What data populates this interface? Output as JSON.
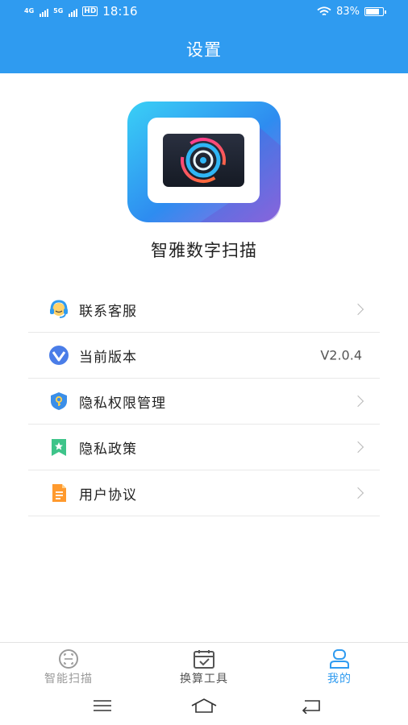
{
  "status_bar": {
    "network_1": "4G",
    "network_2": "5G",
    "hd": "HD",
    "time": "18:16",
    "battery_percent": "83%",
    "battery_level": 0.83
  },
  "header": {
    "title": "设置"
  },
  "app": {
    "name": "智雅数字扫描"
  },
  "menu": [
    {
      "label": "联系客服",
      "icon": "customer-service-icon"
    },
    {
      "label": "当前版本",
      "icon": "version-icon",
      "value": "V2.0.4"
    },
    {
      "label": "隐私权限管理",
      "icon": "privacy-shield-icon"
    },
    {
      "label": "隐私政策",
      "icon": "policy-bookmark-icon"
    },
    {
      "label": "用户协议",
      "icon": "document-icon"
    }
  ],
  "tabs": [
    {
      "label": "智能扫描",
      "icon": "smart-scan-icon",
      "active": false
    },
    {
      "label": "换算工具",
      "icon": "calendar-tool-icon",
      "active": false
    },
    {
      "label": "我的",
      "icon": "profile-icon",
      "active": true
    }
  ],
  "colors": {
    "primary": "#2f9bf0",
    "tab_inactive": "#9a9a9a",
    "tab_active": "#2f9bf0"
  }
}
